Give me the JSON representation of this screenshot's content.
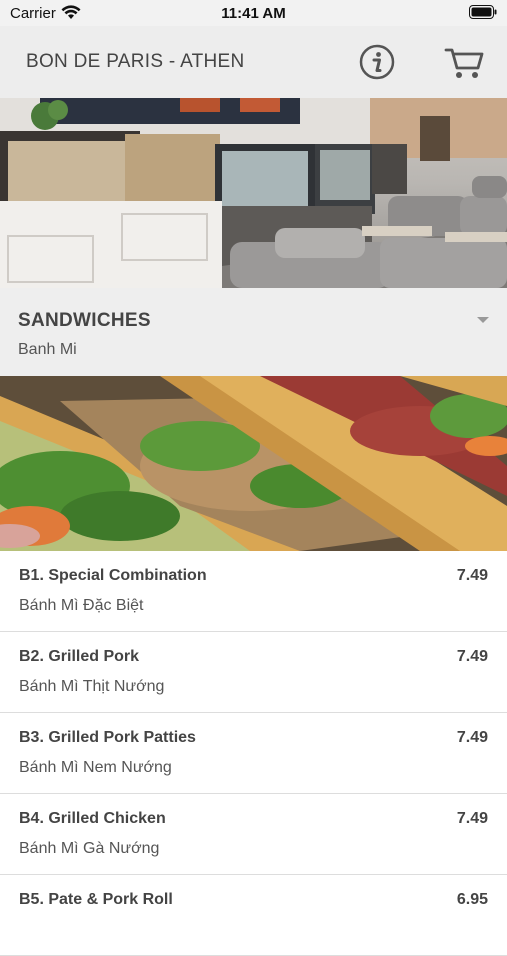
{
  "status_bar": {
    "carrier": "Carrier",
    "time": "11:41 AM"
  },
  "header": {
    "title": "BON DE PARIS - ATHEN",
    "info_icon": "info-icon",
    "cart_icon": "cart-icon"
  },
  "category": {
    "title": "SANDWICHES",
    "subtitle": "Banh Mi",
    "dropdown_icon": "chevron-down-icon"
  },
  "menu": {
    "items": [
      {
        "name": "B1. Special Combination",
        "subtitle": "Bánh Mì Đặc Biệt",
        "price": "7.49"
      },
      {
        "name": "B2. Grilled Pork",
        "subtitle": "Bánh Mì Thịt Nướng",
        "price": "7.49"
      },
      {
        "name": "B3. Grilled Pork Patties",
        "subtitle": "Bánh Mì Nem Nướng",
        "price": "7.49"
      },
      {
        "name": "B4. Grilled Chicken",
        "subtitle": "Bánh Mì Gà Nướng",
        "price": "7.49"
      },
      {
        "name": "B5. Pate & Pork Roll",
        "subtitle": "",
        "price": "6.95"
      }
    ]
  }
}
